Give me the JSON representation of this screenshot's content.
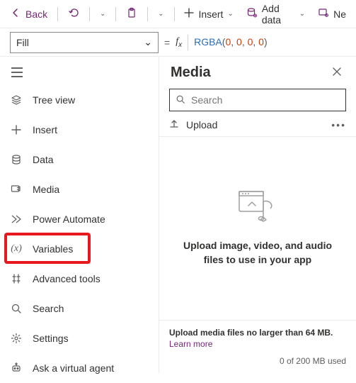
{
  "topbar": {
    "back": "Back",
    "insert": "Insert",
    "add_data": "Add data",
    "new": "Ne"
  },
  "formula": {
    "property": "Fill",
    "fn": "RGBA",
    "args": [
      "0",
      "0",
      "0",
      "0"
    ]
  },
  "sidebar": {
    "items": [
      {
        "label": "Tree view"
      },
      {
        "label": "Insert"
      },
      {
        "label": "Data"
      },
      {
        "label": "Media"
      },
      {
        "label": "Power Automate"
      },
      {
        "label": "Variables"
      },
      {
        "label": "Advanced tools"
      },
      {
        "label": "Search"
      },
      {
        "label": "Settings"
      },
      {
        "label": "Ask a virtual agent"
      }
    ]
  },
  "panel": {
    "title": "Media",
    "search_placeholder": "Search",
    "upload": "Upload",
    "empty_msg": "Upload image, video, and audio files to use in your app",
    "footer_hint": "Upload media files no larger than 64 MB.",
    "learn_more": "Learn more",
    "usage": "0 of 200 MB used"
  }
}
